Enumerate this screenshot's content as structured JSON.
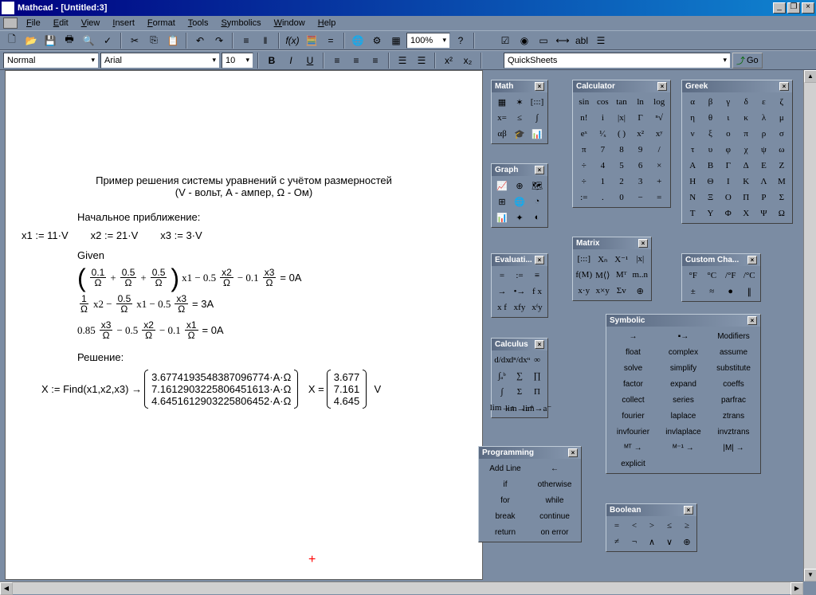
{
  "title": "Mathcad - [Untitled:3]",
  "menu": [
    "File",
    "Edit",
    "View",
    "Insert",
    "Format",
    "Tools",
    "Symbolics",
    "Window",
    "Help"
  ],
  "toolbar1_zoom": "100%",
  "toolbar2": {
    "style": "Normal",
    "font": "Arial",
    "size": "10",
    "quicksheets": "QuickSheets",
    "go": "Go"
  },
  "doc": {
    "title_line1": "Пример решения системы уравнений с учётом размерностей",
    "title_line2": "(V - вольт, A - ампер,   Ω - Ом)",
    "approx_label": "Начальное приближение:",
    "init": [
      "x1 := 11·V",
      "x2 := 21·V",
      "x3 := 3·V"
    ],
    "given": "Given",
    "eq1": {
      "a": "0.1",
      "b": "0.5",
      "c": "0.5",
      "d": "0.5",
      "e": "0.1",
      "Om": "Ω",
      "rhs": "= 0A"
    },
    "eq2": {
      "c1": "1",
      "c2": "0.5",
      "c3": "0.5",
      "rhs": "= 3A"
    },
    "eq3": {
      "c1": "0.85",
      "c2": "0.5",
      "c3": "0.1",
      "rhs": "= 0A"
    },
    "solution_label": "Решение:",
    "find_expr": "X := Find(x1,x2,x3) → ",
    "find_vals": [
      "3.6774193548387096774·A·Ω",
      "7.1612903225806451613·A·Ω",
      "4.6451612903225806452·A·Ω"
    ],
    "Xeq": "X = ",
    "Xvals": [
      "3.677",
      "7.161",
      "4.645"
    ],
    "Xunit": "V"
  },
  "palettes": {
    "math": {
      "title": "Math",
      "rows": [
        [
          "calc",
          "graph",
          "matrix"
        ],
        [
          "x=",
          "fxy",
          "lteq"
        ],
        [
          "int",
          "ab",
          "cap"
        ]
      ]
    },
    "graph": {
      "title": "Graph",
      "rows": [
        [
          "xy",
          "polar",
          "3d"
        ],
        [
          "surf",
          "contour",
          "bar"
        ],
        [
          "vec",
          "scatter",
          "pie"
        ]
      ]
    },
    "eval": {
      "title": "Evaluati...",
      "rows": [
        [
          "=",
          ":=",
          "≡"
        ],
        [
          "→",
          "•→",
          "f x"
        ],
        [
          "x f",
          "xfy",
          "xᶠy"
        ]
      ]
    },
    "calculus": {
      "title": "Calculus",
      "rows": [
        [
          "d/dx",
          "dⁿ/dxⁿ",
          "∞"
        ],
        [
          "∫ₐᵇ",
          "∑",
          "∏"
        ],
        [
          "∫",
          "Σ",
          "Π"
        ],
        [
          "lim→a",
          "lim→a⁺",
          "lim→a⁻"
        ]
      ]
    },
    "programming": {
      "title": "Programming",
      "rows": [
        [
          "Add Line",
          "←"
        ],
        [
          "if",
          "otherwise"
        ],
        [
          "for",
          "while"
        ],
        [
          "break",
          "continue"
        ],
        [
          "return",
          "on error"
        ]
      ]
    },
    "calculator": {
      "title": "Calculator",
      "rows": [
        [
          "sin",
          "cos",
          "tan",
          "ln",
          "log"
        ],
        [
          "n!",
          "i",
          "|x|",
          "Γ",
          "ⁿ√"
        ],
        [
          "eˣ",
          "¹⁄ₓ",
          "( )",
          "x²",
          "xʸ"
        ],
        [
          "π",
          "7",
          "8",
          "9",
          "/"
        ],
        [
          "÷",
          "4",
          "5",
          "6",
          "×"
        ],
        [
          "÷",
          "1",
          "2",
          "3",
          "+"
        ],
        [
          ":=",
          ".",
          "0",
          "−",
          "="
        ]
      ]
    },
    "matrix": {
      "title": "Matrix",
      "rows": [
        [
          "[:::]",
          "Xₙ",
          "X⁻¹",
          "|x|"
        ],
        [
          "f(M)",
          "M⟨⟩",
          "Mᵀ",
          "m..n"
        ],
        [
          "x·y",
          "x×y",
          "Σv",
          "⊕"
        ]
      ]
    },
    "symbolic": {
      "title": "Symbolic",
      "rows": [
        [
          "→",
          "▪→",
          "Modifiers"
        ],
        [
          "float",
          "complex",
          "assume"
        ],
        [
          "solve",
          "simplify",
          "substitute"
        ],
        [
          "factor",
          "expand",
          "coeffs"
        ],
        [
          "collect",
          "series",
          "parfrac"
        ],
        [
          "fourier",
          "laplace",
          "ztrans"
        ],
        [
          "invfourier",
          "invlaplace",
          "invztrans"
        ],
        [
          "ᴹᵀ →",
          "ᴹ⁻¹ →",
          "|M| →"
        ],
        [
          "explicit",
          "",
          ""
        ]
      ]
    },
    "boolean": {
      "title": "Boolean",
      "rows": [
        [
          "=",
          "<",
          ">",
          "≤",
          "≥"
        ],
        [
          "≠",
          "¬",
          "∧",
          "∨",
          "⊕"
        ]
      ]
    },
    "greek": {
      "title": "Greek",
      "rows": [
        [
          "α",
          "β",
          "γ",
          "δ",
          "ε",
          "ζ"
        ],
        [
          "η",
          "θ",
          "ι",
          "κ",
          "λ",
          "μ"
        ],
        [
          "ν",
          "ξ",
          "ο",
          "π",
          "ρ",
          "σ"
        ],
        [
          "τ",
          "υ",
          "φ",
          "χ",
          "ψ",
          "ω"
        ],
        [
          "Α",
          "Β",
          "Γ",
          "Δ",
          "Ε",
          "Ζ"
        ],
        [
          "Η",
          "Θ",
          "Ι",
          "Κ",
          "Λ",
          "Μ"
        ],
        [
          "Ν",
          "Ξ",
          "Ο",
          "Π",
          "Ρ",
          "Σ"
        ],
        [
          "Τ",
          "Υ",
          "Φ",
          "Χ",
          "Ψ",
          "Ω"
        ]
      ]
    },
    "custom": {
      "title": "Custom Cha...",
      "rows": [
        [
          "°F",
          "°C",
          "/°F",
          "/°C"
        ],
        [
          "±",
          "≈",
          "●",
          "∥"
        ]
      ]
    }
  }
}
